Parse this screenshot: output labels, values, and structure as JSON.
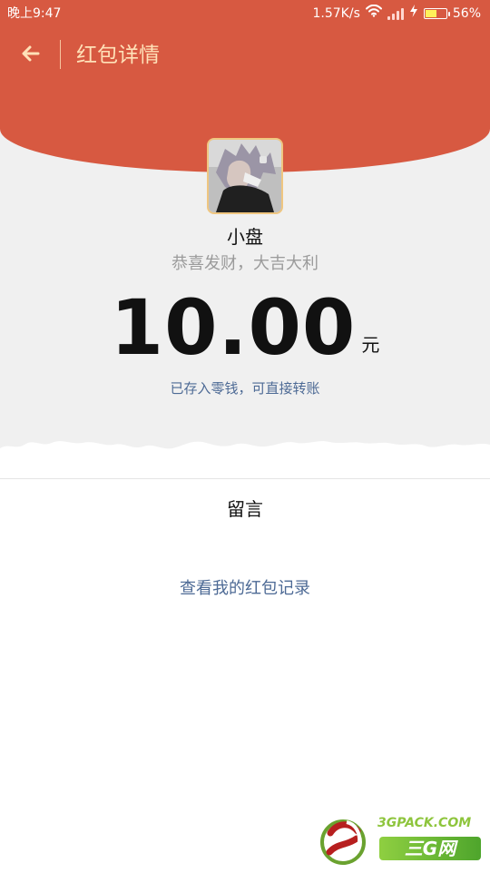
{
  "status_bar": {
    "time": "晚上9:47",
    "network_speed": "1.57K/s",
    "battery": "56%",
    "battery_level": 0.56,
    "icons": {
      "wifi": "wifi-icon",
      "signal": "signal-icon",
      "charging": "charging-icon",
      "battery": "battery-icon"
    }
  },
  "navigation": {
    "back_icon": "back-arrow-icon",
    "title": "红包详情"
  },
  "red_packet": {
    "sender_name": "小盘",
    "blessing": "恭喜发财，大吉大利",
    "amount": "10.00",
    "unit": "元",
    "saved_note": "已存入零钱，可直接转账"
  },
  "message_section": {
    "label": "留言"
  },
  "record_link": {
    "text": "查看我的红包记录"
  },
  "watermark": {
    "top_text": "3GPACK.COM",
    "bottom_text": "三G网"
  },
  "colors": {
    "header_red": "#d75941",
    "header_text": "#ffe1b8",
    "link_blue": "#4d6a95",
    "page_gray": "#f0f0f0",
    "page_white": "#ffffff"
  }
}
